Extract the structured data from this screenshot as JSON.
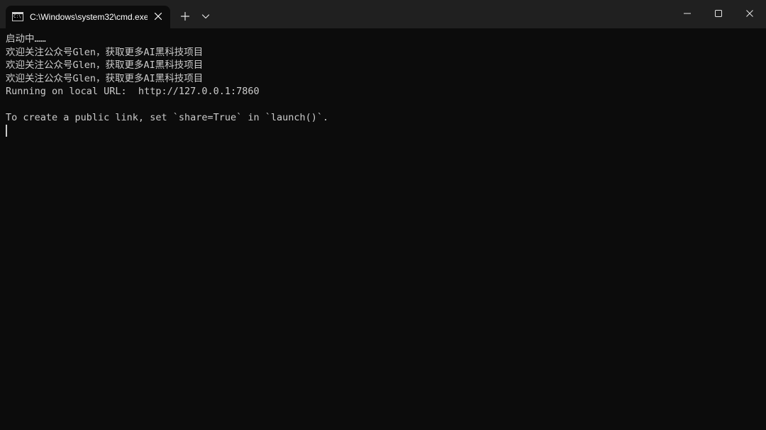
{
  "window": {
    "tab": {
      "icon": "cmd-icon",
      "icon_text": "C:\\",
      "title": "C:\\Windows\\system32\\cmd.exe"
    },
    "controls": {
      "new_tab_icon": "plus-icon",
      "dropdown_icon": "chevron-down-icon",
      "minimize_icon": "minimize-icon",
      "maximize_icon": "maximize-icon",
      "close_icon": "close-icon"
    }
  },
  "console": {
    "lines": [
      "启动中……",
      "欢迎关注公众号Glen，获取更多AI黑科技项目",
      "欢迎关注公众号Glen，获取更多AI黑科技项目",
      "欢迎关注公众号Glen，获取更多AI黑科技项目",
      "Running on local URL:  http://127.0.0.1:7860",
      "",
      "To create a public link, set `share=True` in `launch()`."
    ]
  },
  "colors": {
    "titlebar": "#202020",
    "background": "#0c0c0c",
    "text": "#cccccc"
  }
}
